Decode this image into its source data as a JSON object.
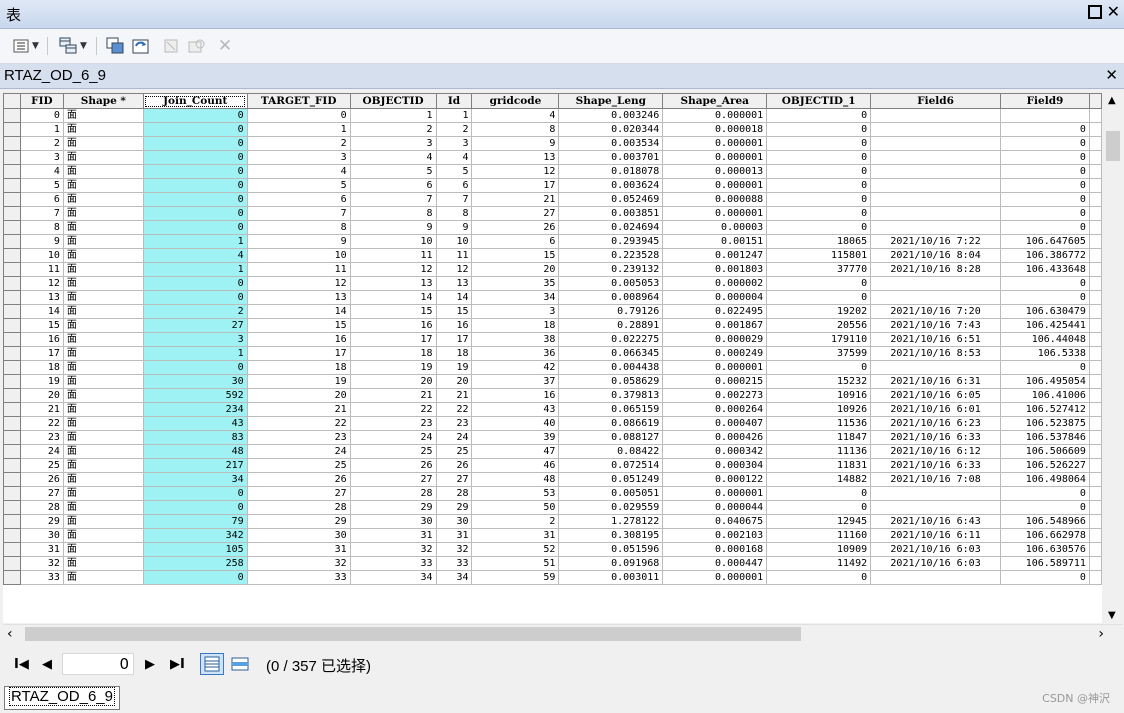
{
  "window": {
    "title": "表"
  },
  "toolbar": {
    "buttons": [
      "table-options",
      "related-tables",
      "select-by-attributes",
      "switch-selection",
      "clear-selection",
      "zoom-to-selected",
      "delete-selected"
    ]
  },
  "table_tab": {
    "name": "RTAZ_OD_6_9"
  },
  "grid": {
    "columns": [
      "FID",
      "Shape *",
      "Join_Count",
      "TARGET_FID",
      "OBJECTID",
      "Id",
      "gridcode",
      "Shape_Leng",
      "Shape_Area",
      "OBJECTID_1",
      "Field6",
      "Field9"
    ],
    "rows": [
      [
        "0",
        "面",
        "0",
        "0",
        "1",
        "1",
        "4",
        "0.003246",
        "0.000001",
        "0",
        "",
        ""
      ],
      [
        "1",
        "面",
        "0",
        "1",
        "2",
        "2",
        "8",
        "0.020344",
        "0.000018",
        "0",
        "",
        "0"
      ],
      [
        "2",
        "面",
        "0",
        "2",
        "3",
        "3",
        "9",
        "0.003534",
        "0.000001",
        "0",
        "",
        "0"
      ],
      [
        "3",
        "面",
        "0",
        "3",
        "4",
        "4",
        "13",
        "0.003701",
        "0.000001",
        "0",
        "",
        "0"
      ],
      [
        "4",
        "面",
        "0",
        "4",
        "5",
        "5",
        "12",
        "0.018078",
        "0.000013",
        "0",
        "",
        "0"
      ],
      [
        "5",
        "面",
        "0",
        "5",
        "6",
        "6",
        "17",
        "0.003624",
        "0.000001",
        "0",
        "",
        "0"
      ],
      [
        "6",
        "面",
        "0",
        "6",
        "7",
        "7",
        "21",
        "0.052469",
        "0.000088",
        "0",
        "",
        "0"
      ],
      [
        "7",
        "面",
        "0",
        "7",
        "8",
        "8",
        "27",
        "0.003851",
        "0.000001",
        "0",
        "",
        "0"
      ],
      [
        "8",
        "面",
        "0",
        "8",
        "9",
        "9",
        "26",
        "0.024694",
        "0.00003",
        "0",
        "",
        "0"
      ],
      [
        "9",
        "面",
        "1",
        "9",
        "10",
        "10",
        "6",
        "0.293945",
        "0.00151",
        "18065",
        "2021/10/16 7:22",
        "106.647605"
      ],
      [
        "10",
        "面",
        "4",
        "10",
        "11",
        "11",
        "15",
        "0.223528",
        "0.001247",
        "115801",
        "2021/10/16 8:04",
        "106.386772"
      ],
      [
        "11",
        "面",
        "1",
        "11",
        "12",
        "12",
        "20",
        "0.239132",
        "0.001803",
        "37770",
        "2021/10/16 8:28",
        "106.433648"
      ],
      [
        "12",
        "面",
        "0",
        "12",
        "13",
        "13",
        "35",
        "0.005053",
        "0.000002",
        "0",
        "",
        "0"
      ],
      [
        "13",
        "面",
        "0",
        "13",
        "14",
        "14",
        "34",
        "0.008964",
        "0.000004",
        "0",
        "",
        "0"
      ],
      [
        "14",
        "面",
        "2",
        "14",
        "15",
        "15",
        "3",
        "0.79126",
        "0.022495",
        "19202",
        "2021/10/16 7:20",
        "106.630479"
      ],
      [
        "15",
        "面",
        "27",
        "15",
        "16",
        "16",
        "18",
        "0.28891",
        "0.001867",
        "20556",
        "2021/10/16 7:43",
        "106.425441"
      ],
      [
        "16",
        "面",
        "3",
        "16",
        "17",
        "17",
        "38",
        "0.022275",
        "0.000029",
        "179110",
        "2021/10/16 6:51",
        "106.44048"
      ],
      [
        "17",
        "面",
        "1",
        "17",
        "18",
        "18",
        "36",
        "0.066345",
        "0.000249",
        "37599",
        "2021/10/16 8:53",
        "106.5338"
      ],
      [
        "18",
        "面",
        "0",
        "18",
        "19",
        "19",
        "42",
        "0.004438",
        "0.000001",
        "0",
        "",
        "0"
      ],
      [
        "19",
        "面",
        "30",
        "19",
        "20",
        "20",
        "37",
        "0.058629",
        "0.000215",
        "15232",
        "2021/10/16 6:31",
        "106.495054"
      ],
      [
        "20",
        "面",
        "592",
        "20",
        "21",
        "21",
        "16",
        "0.379813",
        "0.002273",
        "10916",
        "2021/10/16 6:05",
        "106.41006"
      ],
      [
        "21",
        "面",
        "234",
        "21",
        "22",
        "22",
        "43",
        "0.065159",
        "0.000264",
        "10926",
        "2021/10/16 6:01",
        "106.527412"
      ],
      [
        "22",
        "面",
        "43",
        "22",
        "23",
        "23",
        "40",
        "0.086619",
        "0.000407",
        "11536",
        "2021/10/16 6:23",
        "106.523875"
      ],
      [
        "23",
        "面",
        "83",
        "23",
        "24",
        "24",
        "39",
        "0.088127",
        "0.000426",
        "11847",
        "2021/10/16 6:33",
        "106.537846"
      ],
      [
        "24",
        "面",
        "48",
        "24",
        "25",
        "25",
        "47",
        "0.08422",
        "0.000342",
        "11136",
        "2021/10/16 6:12",
        "106.506609"
      ],
      [
        "25",
        "面",
        "217",
        "25",
        "26",
        "26",
        "46",
        "0.072514",
        "0.000304",
        "11831",
        "2021/10/16 6:33",
        "106.526227"
      ],
      [
        "26",
        "面",
        "34",
        "26",
        "27",
        "27",
        "48",
        "0.051249",
        "0.000122",
        "14882",
        "2021/10/16 7:08",
        "106.498064"
      ],
      [
        "27",
        "面",
        "0",
        "27",
        "28",
        "28",
        "53",
        "0.005051",
        "0.000001",
        "0",
        "",
        "0"
      ],
      [
        "28",
        "面",
        "0",
        "28",
        "29",
        "29",
        "50",
        "0.029559",
        "0.000044",
        "0",
        "",
        "0"
      ],
      [
        "29",
        "面",
        "79",
        "29",
        "30",
        "30",
        "2",
        "1.278122",
        "0.040675",
        "12945",
        "2021/10/16 6:43",
        "106.548966"
      ],
      [
        "30",
        "面",
        "342",
        "30",
        "31",
        "31",
        "31",
        "0.308195",
        "0.002103",
        "11160",
        "2021/10/16 6:11",
        "106.662978"
      ],
      [
        "31",
        "面",
        "105",
        "31",
        "32",
        "32",
        "52",
        "0.051596",
        "0.000168",
        "10909",
        "2021/10/16 6:03",
        "106.630576"
      ],
      [
        "32",
        "面",
        "258",
        "32",
        "33",
        "33",
        "51",
        "0.091968",
        "0.000447",
        "11492",
        "2021/10/16 6:03",
        "106.589711"
      ],
      [
        "33",
        "面",
        "0",
        "33",
        "34",
        "34",
        "59",
        "0.003011",
        "0.000001",
        "0",
        "",
        "0"
      ]
    ]
  },
  "navigation": {
    "current_record": "0",
    "selection_status": "(0 / 357 已选择)"
  },
  "bottom_tab": {
    "label": "RTAZ_OD_6_9"
  },
  "watermark": "CSDN @神沢",
  "colors": {
    "highlight_column": "#9ff2f4",
    "header_bar": "#d5dfee"
  }
}
